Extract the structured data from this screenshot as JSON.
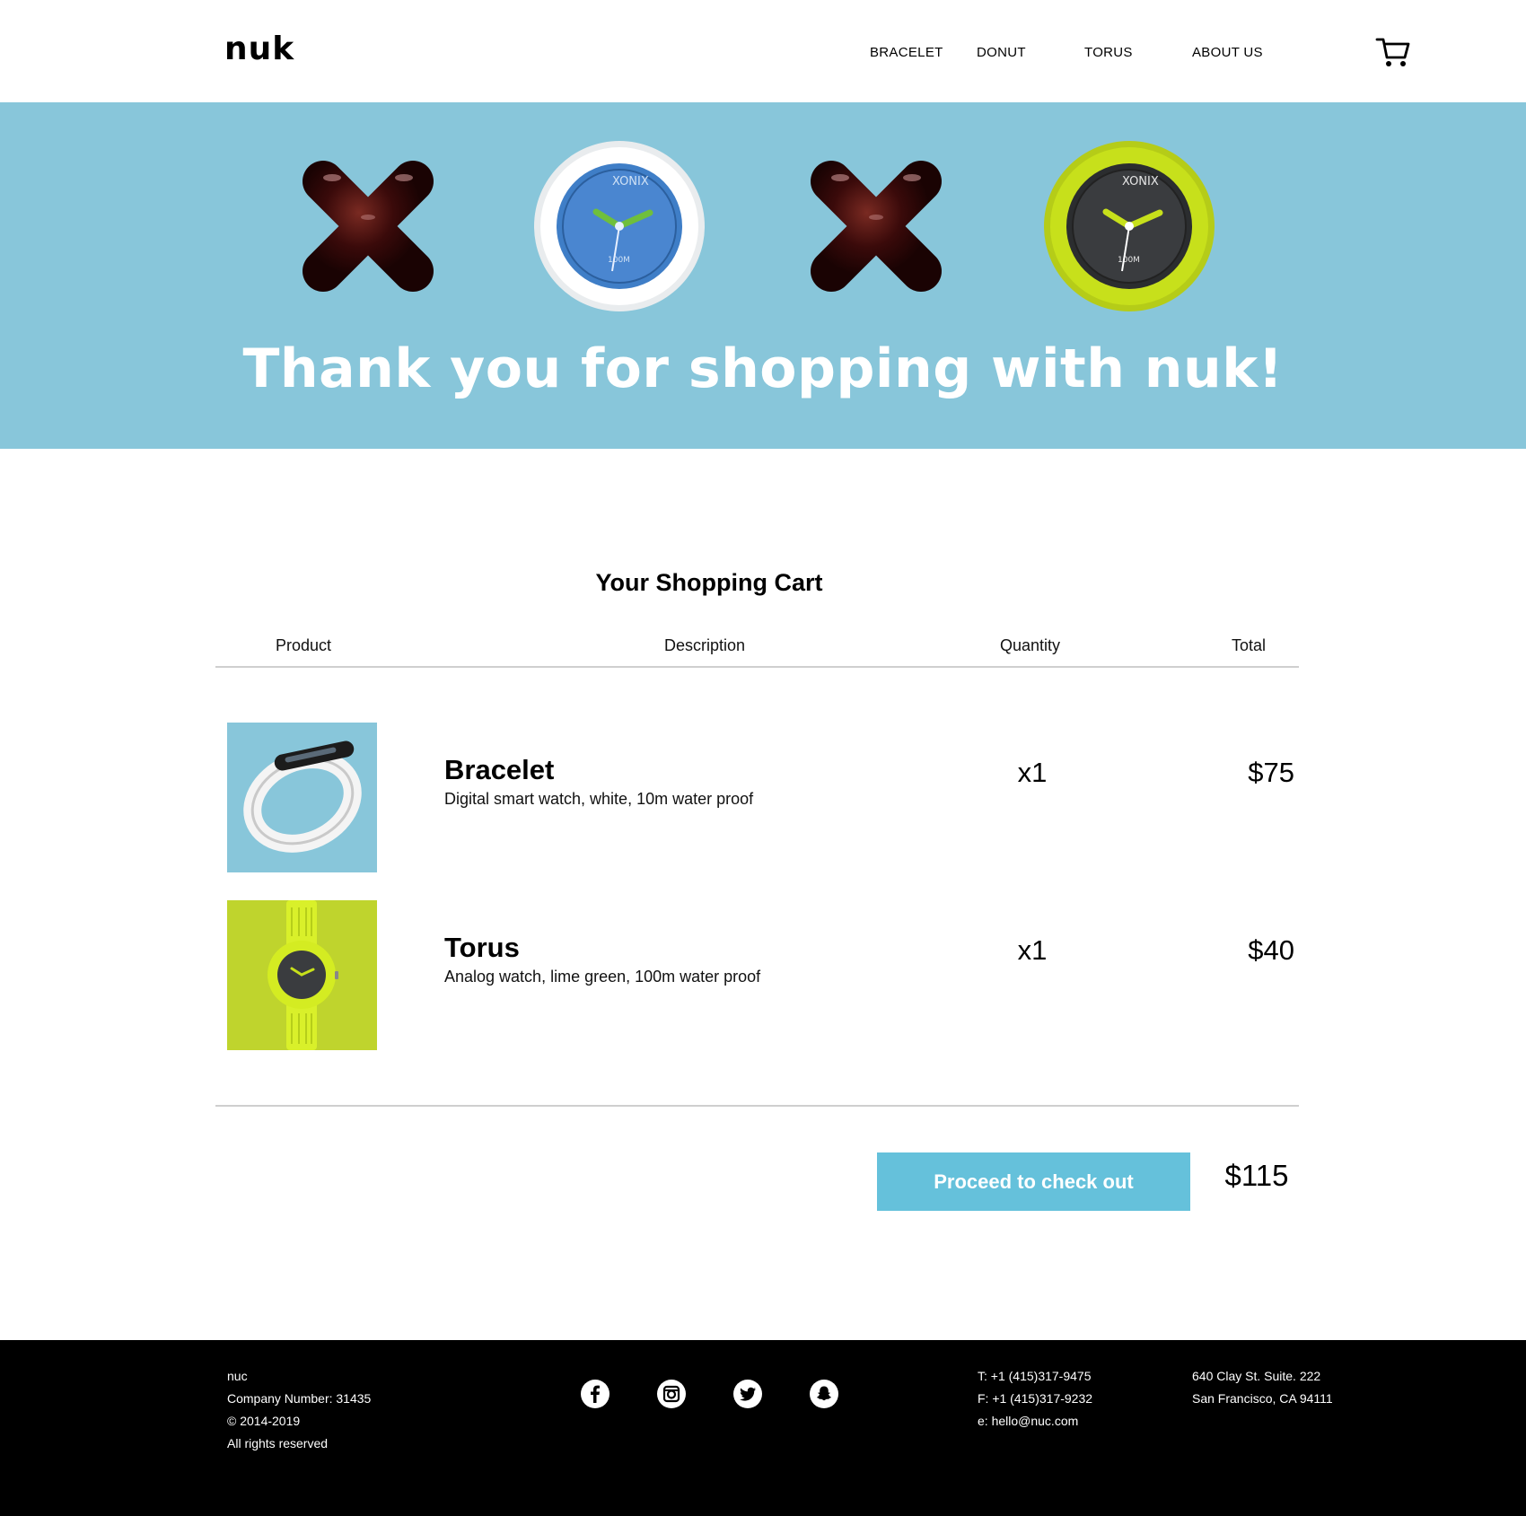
{
  "header": {
    "logo": "nuk",
    "nav": [
      "BRACELET",
      "DONUT",
      "TORUS",
      "ABOUT US"
    ],
    "cart_icon": "shopping-cart-icon"
  },
  "hero": {
    "title": "Thank you for shopping with nuk!",
    "watch_brand": "XONIX",
    "watch_depth": "100M",
    "colors": {
      "background": "#88c6da",
      "cross": "#3a0a0a",
      "lime": "#c7e01b"
    }
  },
  "cart": {
    "title": "Your Shopping Cart",
    "columns": [
      "Product",
      "Description",
      "Quantity",
      "Total"
    ],
    "items": [
      {
        "name": "Bracelet",
        "description": "Digital smart watch, white, 10m water proof",
        "quantity": "x1",
        "total": "$75",
        "thumb_bg": "#88c6da"
      },
      {
        "name": "Torus",
        "description": "Analog watch, lime green, 100m water proof",
        "quantity": "x1",
        "total": "$40",
        "thumb_bg": "#bfd42d"
      }
    ],
    "checkout_label": "Proceed to check out",
    "grand_total": "$115",
    "accent": "#65c1db"
  },
  "footer": {
    "company": [
      "nuc",
      "Company Number: 31435",
      "© 2014-2019",
      "All rights reserved"
    ],
    "social_icons": [
      "facebook-icon",
      "instagram-icon",
      "twitter-icon",
      "snapchat-icon"
    ],
    "contact": [
      "T: +1 (415)317-9475",
      "F: +1 (415)317-9232",
      "e: hello@nuc.com"
    ],
    "address": [
      "640 Clay St. Suite. 222",
      "San Francisco, CA 94111"
    ]
  }
}
